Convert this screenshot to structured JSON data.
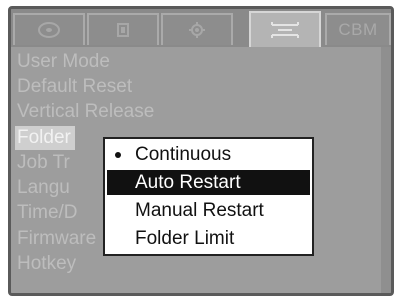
{
  "tabs": [
    {
      "icon": "disc-icon",
      "label": ""
    },
    {
      "icon": "tray-icon",
      "label": ""
    },
    {
      "icon": "gear-icon",
      "label": ""
    },
    {
      "icon": "wrench-icon",
      "label": "",
      "active": true
    },
    {
      "icon": "",
      "label": "CBM"
    }
  ],
  "menu": {
    "items": [
      {
        "label": "User Mode"
      },
      {
        "label": "Default Reset"
      },
      {
        "label": "Vertical Release"
      },
      {
        "label": "Folder",
        "highlighted": true
      },
      {
        "label": "Job Tr"
      },
      {
        "label": "Langu"
      },
      {
        "label": "Time/D"
      },
      {
        "label": "Firmware"
      },
      {
        "label": "Hotkey"
      }
    ]
  },
  "popup": {
    "options": [
      {
        "label": "Continuous",
        "checked": true
      },
      {
        "label": "Auto Restart",
        "selected": true
      },
      {
        "label": "Manual Restart"
      },
      {
        "label": "Folder Limit"
      }
    ]
  }
}
